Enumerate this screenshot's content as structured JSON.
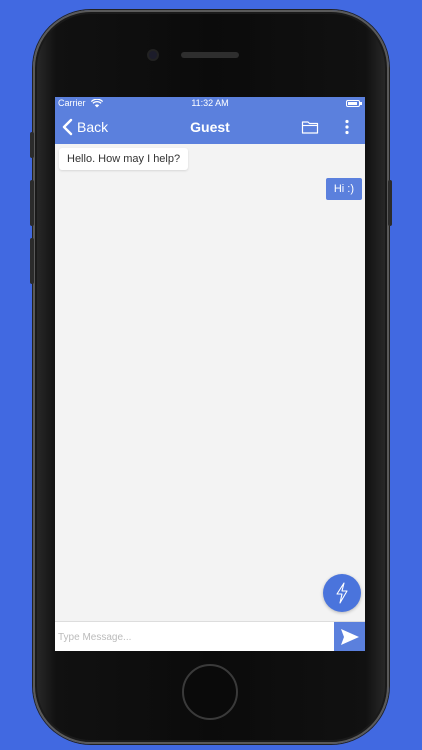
{
  "status_bar": {
    "carrier": "Carrier",
    "time": "11:32 AM",
    "wifi_icon": "wifi-icon",
    "battery_icon": "battery-icon"
  },
  "nav": {
    "back_label": "Back",
    "back_icon": "chevron-left-icon",
    "title": "Guest",
    "folder_icon": "folder-icon",
    "more_icon": "more-vertical-icon"
  },
  "messages": [
    {
      "direction": "incoming",
      "text": "Hello. How may I help?"
    },
    {
      "direction": "outgoing",
      "text": "Hi :)"
    }
  ],
  "fab": {
    "icon": "lightning-icon"
  },
  "composer": {
    "placeholder": "Type Message...",
    "value": "",
    "send_icon": "send-icon"
  },
  "colors": {
    "background": "#4169e1",
    "accent": "#5b80dd",
    "chat_background": "#f3f3f3"
  }
}
